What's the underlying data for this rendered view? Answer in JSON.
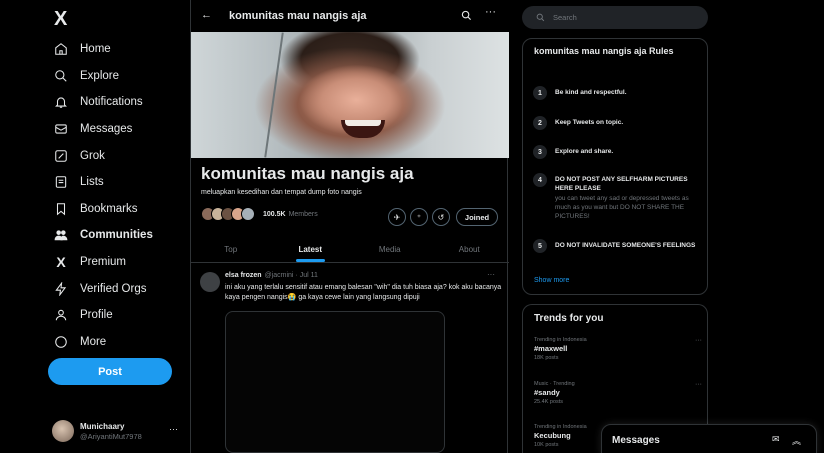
{
  "logo": "X",
  "nav": [
    {
      "label": "Home",
      "icon": "home-icon"
    },
    {
      "label": "Explore",
      "icon": "search-icon"
    },
    {
      "label": "Notifications",
      "icon": "bell-icon"
    },
    {
      "label": "Messages",
      "icon": "mail-icon"
    },
    {
      "label": "Grok",
      "icon": "grok-icon"
    },
    {
      "label": "Lists",
      "icon": "list-icon"
    },
    {
      "label": "Bookmarks",
      "icon": "bookmark-icon"
    },
    {
      "label": "Communities",
      "icon": "communities-icon"
    },
    {
      "label": "Premium",
      "icon": "x-premium-icon"
    },
    {
      "label": "Verified Orgs",
      "icon": "lightning-icon"
    },
    {
      "label": "Profile",
      "icon": "person-icon"
    },
    {
      "label": "More",
      "icon": "more-circle-icon"
    }
  ],
  "post_label": "Post",
  "account": {
    "name": "Munichaary",
    "handle": "@AriyantiMut7978"
  },
  "community": {
    "header_title": "komunitas mau nangis aja",
    "name": "komunitas mau nangis aja",
    "description": "meluapkan kesedihan dan tempat dump foto nangis",
    "member_count": "100.5K",
    "member_label": "Members",
    "joined_label": "Joined"
  },
  "tabs": [
    "Top",
    "Latest",
    "Media",
    "About"
  ],
  "tweet": {
    "name": "elsa frozen",
    "handle": "@jacmini · Jul 11",
    "text": "ini aku yang terlalu sensitif atau emang balesan \"wih\" dia tuh biasa aja? kok aku bacanya kaya pengen nangis😭 ga kaya cewe lain yang langsung dipuji"
  },
  "search_placeholder": "Search",
  "rules": {
    "title": "komunitas mau nangis aja Rules",
    "items": [
      {
        "n": "1",
        "title": "Be kind and respectful.",
        "desc": ""
      },
      {
        "n": "2",
        "title": "Keep Tweets on topic.",
        "desc": ""
      },
      {
        "n": "3",
        "title": "Explore and share.",
        "desc": ""
      },
      {
        "n": "4",
        "title": "DO NOT POST ANY SELFHARM PICTURES HERE PLEASE",
        "desc": "you can tweet any sad or depressed tweets as much as you want but DO NOT SHARE THE PICTURES!"
      },
      {
        "n": "5",
        "title": "DO NOT INVALIDATE SOMEONE'S FEELINGS",
        "desc": ""
      }
    ],
    "show_more": "Show more"
  },
  "trends": {
    "title": "Trends for you",
    "items": [
      {
        "context": "Trending in Indonesia",
        "tag": "#maxwell",
        "posts": "18K posts"
      },
      {
        "context": "Music · Trending",
        "tag": "#sandy",
        "posts": "25.4K posts"
      },
      {
        "context": "Trending in Indonesia",
        "tag": "Kecubung",
        "posts": "10K posts"
      }
    ]
  },
  "messages_label": "Messages",
  "colors": {
    "accent": "#1d9bf0",
    "bg": "#000000",
    "border": "#2f3336",
    "muted": "#71767b"
  }
}
